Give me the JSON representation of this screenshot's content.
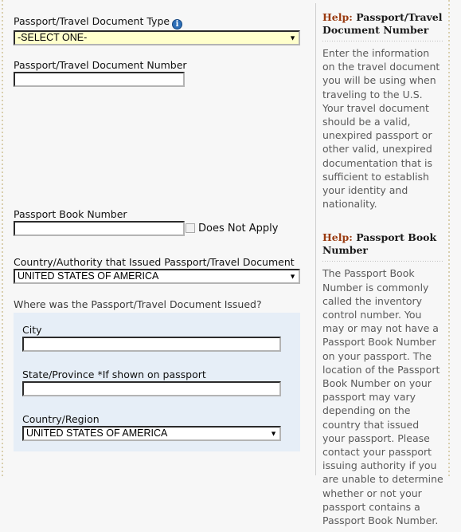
{
  "colors": {
    "page_background": "#f7f7f7",
    "highlight_select": "#ffffcc",
    "issued_panel": "#e6eef7",
    "help_keyword": "#9a3b10",
    "help_body_text": "#5a5a5a",
    "info_icon": "#2d6fb8"
  },
  "form": {
    "doc_type": {
      "label": "Passport/Travel Document Type",
      "info_icon_glyph": "i",
      "value": "-SELECT ONE-",
      "arrow": "▼"
    },
    "doc_number": {
      "label": "Passport/Travel Document Number",
      "value": "",
      "placeholder": ""
    },
    "book_number": {
      "label": "Passport Book Number",
      "value": "",
      "placeholder": "",
      "checkbox_label": "Does Not Apply",
      "checked": false
    },
    "issuing_country": {
      "label": "Country/Authority that Issued Passport/Travel Document",
      "value": "UNITED STATES OF AMERICA",
      "arrow": "▼"
    },
    "issued_section": {
      "heading": "Where was the Passport/Travel Document Issued?",
      "city": {
        "label": "City",
        "value": "",
        "placeholder": ""
      },
      "state": {
        "label": "State/Province *If shown on passport",
        "value": "",
        "placeholder": ""
      },
      "country": {
        "label": "Country/Region",
        "value": "UNITED STATES OF AMERICA",
        "arrow": "▼"
      }
    }
  },
  "help": {
    "blocks": [
      {
        "keyword": "Help:",
        "title": " Passport/Travel Document Number",
        "body": "Enter the information on the travel document you will be using when traveling to the U.S. Your travel document should be a valid, unexpired passport or other valid, unexpired documentation that is sufficient to establish your identity and nationality."
      },
      {
        "keyword": "Help:",
        "title": " Passport Book Number",
        "body": "The Passport Book Number is commonly called the inventory control number. You may or may not have a Passport Book Number on your passport. The location of the Passport Book Number on your passport may vary depending on the country that issued your passport. Please contact your passport issuing authority if you are unable to determine whether or not your passport contains a Passport Book Number."
      }
    ]
  }
}
